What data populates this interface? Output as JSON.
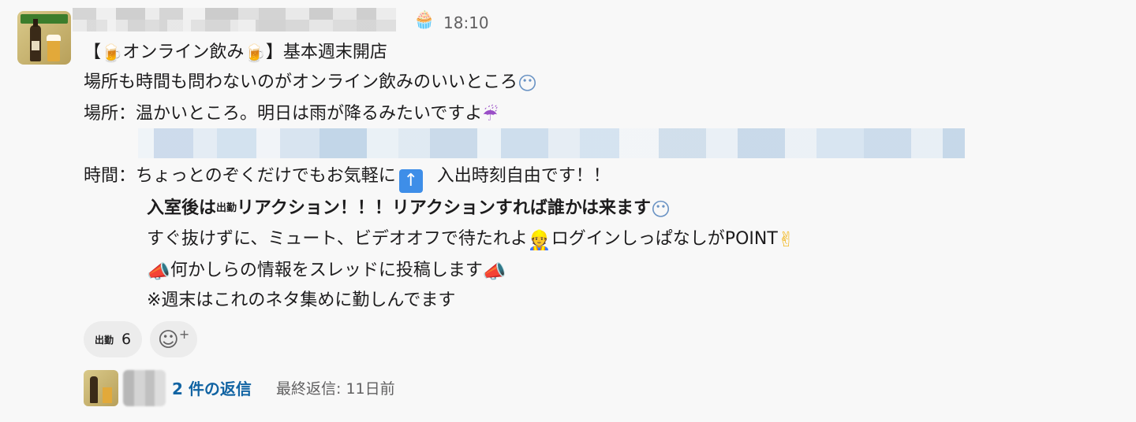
{
  "header": {
    "status_emoji": "cupcake-icon",
    "timestamp": "18:10"
  },
  "message": {
    "title_open": "【",
    "title_text": "オンライン飲み",
    "title_close": "】基本週末開店",
    "line1": "場所も時間も問わないのがオンライン飲みのいいところ",
    "line2": "場所：温かいところ。明日は雨が降るみたいですよ",
    "line4_label": "時間：",
    "line4_text": "ちょっとのぞくだけでもお気軽に",
    "line4_tail": "入出時刻自由です！！",
    "line5_a": "入室後は",
    "line5_b": "リアクション！！！リアクションすれば誰かは来ます",
    "line6_a": "すぐ抜けずに、ミュート、ビデオオフで待たれよ",
    "line6_b": "ログインしっぱなしがPOINT",
    "line7": "何かしらの情報をスレッドに投稿します",
    "line8": "※週末はこれのネタ集めに勤しんでます",
    "shukkin_emoji": "出勤",
    "icons": {
      "beer": "beer-mug-icon",
      "face": "face-icon",
      "umbrella": "umbrella-icon",
      "arrow": "up-arrow-icon",
      "worker": "construction-worker-icon",
      "peace": "victory-hand-icon",
      "megaphone": "megaphone-icon"
    }
  },
  "reactions": [
    {
      "emoji": "出勤",
      "count": "6"
    }
  ],
  "add_reaction": "add-reaction-icon",
  "thread": {
    "reply_count": "2 件の返信",
    "last_reply": "最終返信: 11日前"
  }
}
